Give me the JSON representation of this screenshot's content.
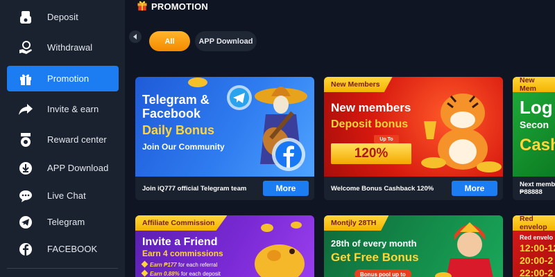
{
  "sidebar": {
    "items": [
      {
        "label": "Deposit",
        "icon": "deposit-icon"
      },
      {
        "label": "Withdrawal",
        "icon": "withdrawal-icon"
      },
      {
        "label": "Promotion",
        "icon": "gift-icon",
        "active": true
      },
      {
        "label": "Invite & earn",
        "icon": "share-arrow-icon"
      },
      {
        "label": "Reward center",
        "icon": "medal-icon"
      },
      {
        "label": "APP Download",
        "icon": "download-icon"
      },
      {
        "label": "Live Chat",
        "icon": "chat-icon"
      },
      {
        "label": "Telegram",
        "icon": "telegram-icon"
      },
      {
        "label": "FACEBOOK",
        "icon": "facebook-icon"
      }
    ]
  },
  "header": {
    "title": "PROMOTION",
    "icon": "gift-icon"
  },
  "filters": {
    "all": "All",
    "app": "APP Download"
  },
  "cards": [
    {
      "l1": "Telegram &",
      "l2": "Facebook",
      "l3": "Daily Bonus",
      "l4": "Join Our Community",
      "desc": "Join iQ777 official Telegram team",
      "more": "More"
    },
    {
      "tag": "New Members",
      "l1": "New members",
      "l2": "Deposit bonus",
      "upto": "Up To",
      "pct": "120%",
      "desc": "Welcome Bonus Cashback 120%",
      "more": "More"
    },
    {
      "tag": "New Mem",
      "l1": "Log",
      "l2": "Secon",
      "l3": "Cash",
      "desc": "Next memb",
      "desc2": "₱88888"
    },
    {
      "tag": "Affiliate Commission",
      "l1": "Invite a Friend",
      "l2": "Earn 4 commissions",
      "r1a": "Earn ₱177",
      "r1b": "for each referral",
      "r2a": "Earn 0.88%",
      "r2b": "for each deposit"
    },
    {
      "tag": "Montjly 28TH",
      "l1": "28th of every month",
      "l2": "Get Free Bonus",
      "pill": "Bonus pool up to"
    },
    {
      "tag": "Red envelop",
      "l1": "Red envelo",
      "t1": "12:00-12",
      "t2": "20:00-2",
      "t3": "22:00-2"
    }
  ],
  "colors": {
    "accent": "#1c7cf1",
    "orange": "#f58a00",
    "yellow": "#ffd63a"
  }
}
